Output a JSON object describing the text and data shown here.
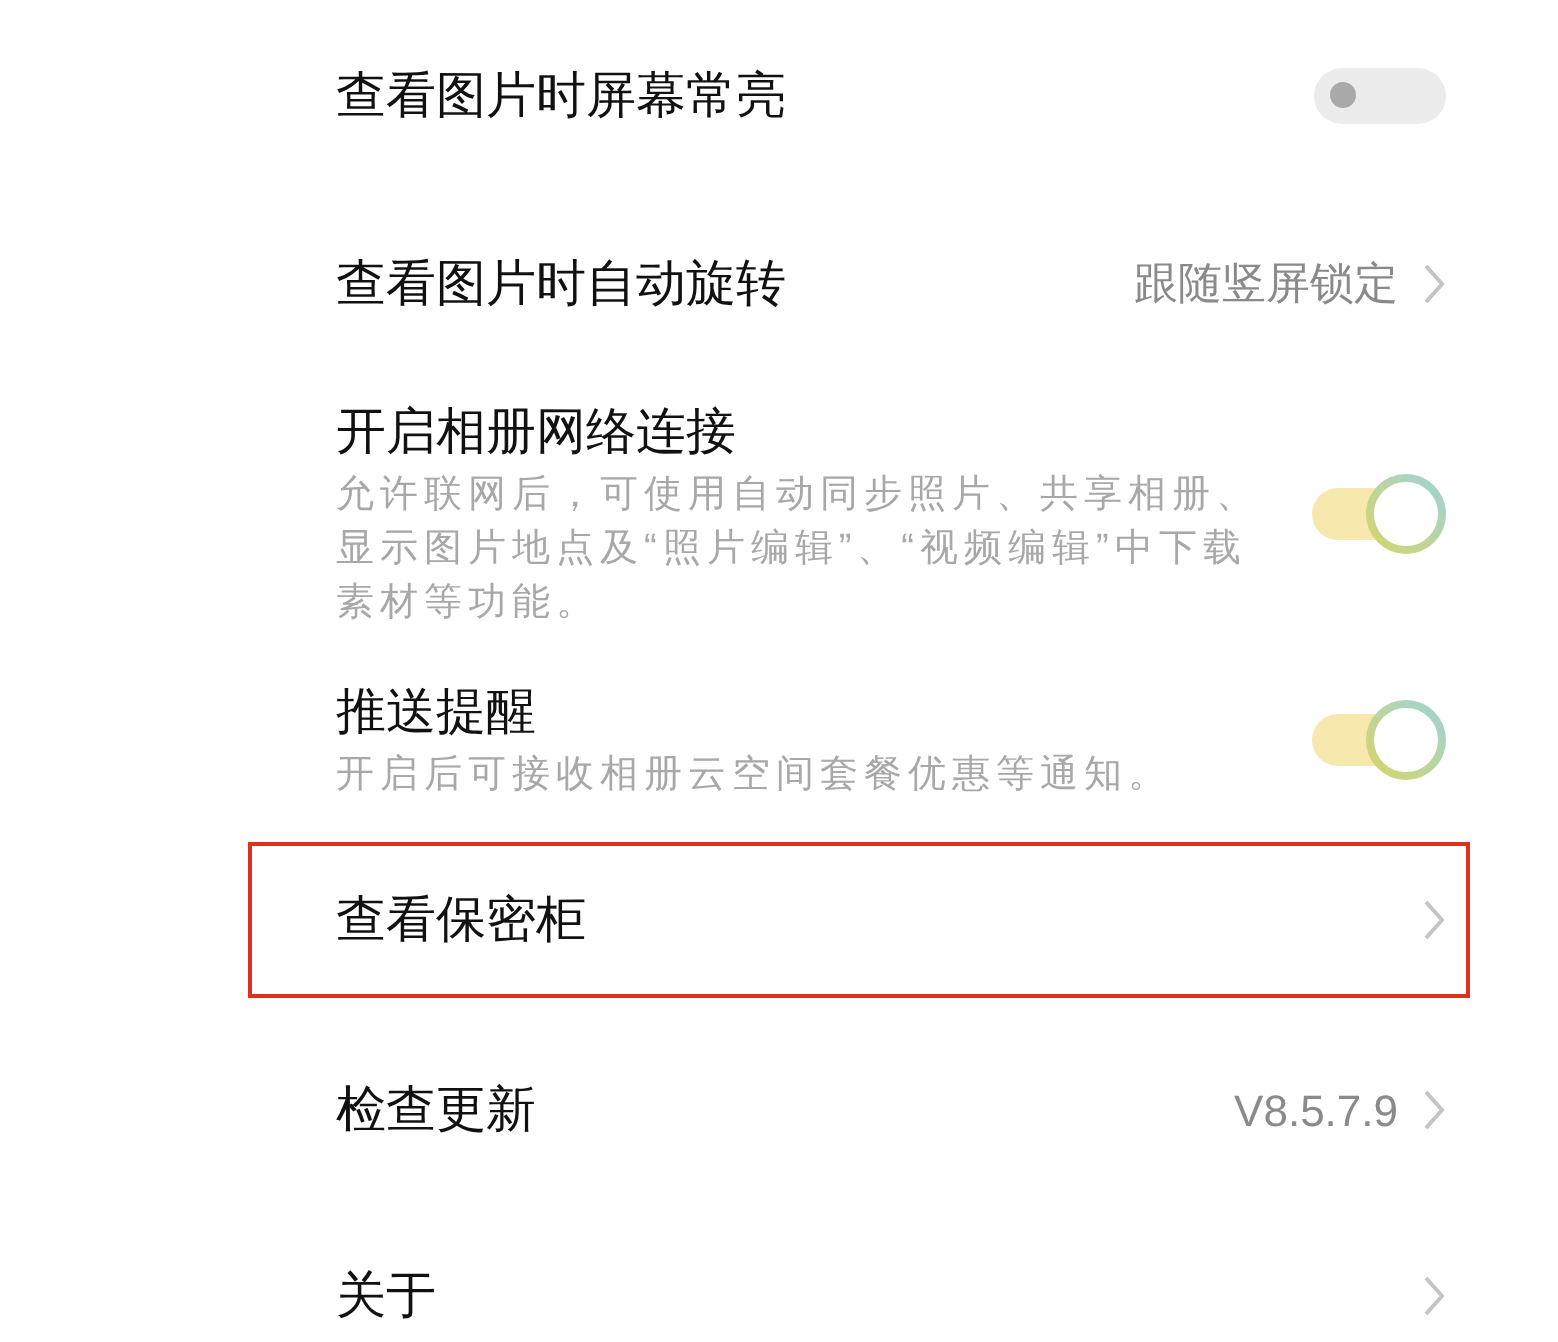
{
  "rows": [
    {
      "kind": "toggle",
      "title": "查看图片时屏幕常亮",
      "on": false,
      "highlighted": false
    },
    {
      "kind": "link",
      "title": "查看图片时自动旋转",
      "value": "跟随竖屏锁定",
      "highlighted": false
    },
    {
      "kind": "toggle",
      "title": "开启相册网络连接",
      "description": "允许联网后，可使用自动同步照片、共享相册、显示图片地点及“照片编辑”、“视频编辑”中下载素材等功能。",
      "on": true,
      "highlighted": false
    },
    {
      "kind": "toggle",
      "title": "推送提醒",
      "description": "开启后可接收相册云空间套餐优惠等通知。",
      "on": true,
      "highlighted": false
    },
    {
      "kind": "link",
      "title": "查看保密柜",
      "highlighted": true
    },
    {
      "kind": "link",
      "title": "检查更新",
      "value": "V8.5.7.9",
      "highlighted": false
    },
    {
      "kind": "link",
      "title": "关于",
      "highlighted": false
    }
  ]
}
